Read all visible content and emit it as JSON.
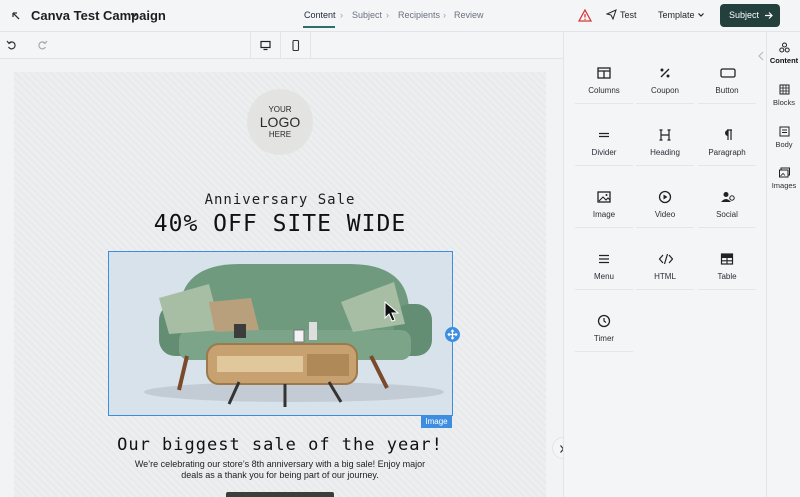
{
  "header": {
    "title": "Canva Test Campaign",
    "steps": [
      {
        "label": "Content",
        "active": true
      },
      {
        "label": "Subject",
        "active": false
      },
      {
        "label": "Recipients",
        "active": false
      },
      {
        "label": "Review",
        "active": false
      }
    ],
    "test_label": "Test",
    "template_label": "Template",
    "subject_label": "Subject"
  },
  "email": {
    "logo": {
      "line1": "YOUR",
      "line2": "LOGO",
      "line3": "HERE"
    },
    "headline_small": "Anniversary Sale",
    "headline_large": "40% OFF SITE WIDE",
    "image_label": "Image",
    "subheadline": "Our biggest sale of the year!",
    "body": "We’re celebrating our store’s 8th anniversary with a big sale! Enjoy major deals as a thank you for being part of our journey."
  },
  "panel": {
    "tiles": [
      {
        "label": "Columns",
        "icon": "columns-icon"
      },
      {
        "label": "Coupon",
        "icon": "coupon-icon"
      },
      {
        "label": "Button",
        "icon": "button-icon"
      },
      {
        "label": "Divider",
        "icon": "divider-icon"
      },
      {
        "label": "Heading",
        "icon": "heading-icon"
      },
      {
        "label": "Paragraph",
        "icon": "paragraph-icon"
      },
      {
        "label": "Image",
        "icon": "image-icon"
      },
      {
        "label": "Video",
        "icon": "video-icon"
      },
      {
        "label": "Social",
        "icon": "social-icon"
      },
      {
        "label": "Menu",
        "icon": "menu-icon"
      },
      {
        "label": "HTML",
        "icon": "html-icon"
      },
      {
        "label": "Table",
        "icon": "table-icon"
      },
      {
        "label": "Timer",
        "icon": "timer-icon"
      }
    ]
  },
  "rnav": {
    "items": [
      {
        "label": "Content",
        "active": true
      },
      {
        "label": "Blocks",
        "active": false
      },
      {
        "label": "Body",
        "active": false
      },
      {
        "label": "Images",
        "active": false
      }
    ]
  },
  "colors": {
    "accent": "#23403d",
    "selection": "#3d8ee0",
    "warning": "#d93636"
  }
}
